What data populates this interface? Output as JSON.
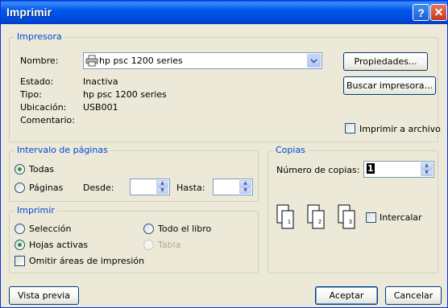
{
  "window": {
    "title": "Imprimir",
    "help_label": "?",
    "close_label": "✕"
  },
  "printer": {
    "legend": "Impresora",
    "name_label": "Nombre:",
    "name_value": "hp psc 1200 series",
    "status_label": "Estado:",
    "status_value": "Inactiva",
    "type_label": "Tipo:",
    "type_value": "hp psc 1200 series",
    "location_label": "Ubicación:",
    "location_value": "USB001",
    "comment_label": "Comentario:",
    "properties_button": "Propiedades...",
    "find_printer_button": "Buscar impresora...",
    "print_to_file_label": "Imprimir a archivo",
    "print_to_file_checked": false
  },
  "page_range": {
    "legend": "Intervalo de páginas",
    "all_label": "Todas",
    "all_selected": true,
    "pages_label": "Páginas",
    "from_label": "Desde:",
    "from_value": "",
    "to_label": "Hasta:",
    "to_value": ""
  },
  "copies": {
    "legend": "Copias",
    "number_label": "Número de copias:",
    "number_value": "1",
    "collate_label": "Intercalar",
    "collate_checked": false,
    "page_icon_labels": [
      "1",
      "1",
      "2",
      "2",
      "3",
      "3"
    ]
  },
  "print_what": {
    "legend": "Imprimir",
    "selection_label": "Selección",
    "whole_book_label": "Todo el libro",
    "active_sheets_label": "Hojas activas",
    "active_sheets_selected": true,
    "table_label": "Tabla",
    "ignore_print_areas_label": "Omitir áreas de impresión",
    "ignore_print_areas_checked": false
  },
  "footer": {
    "preview_button": "Vista previa",
    "ok_button": "Aceptar",
    "cancel_button": "Cancelar"
  },
  "colors": {
    "title_bar": "#0058ee",
    "group_legend": "#0046d5",
    "dialog_bg": "#ece9d8",
    "radio_dot": "#21a121"
  }
}
